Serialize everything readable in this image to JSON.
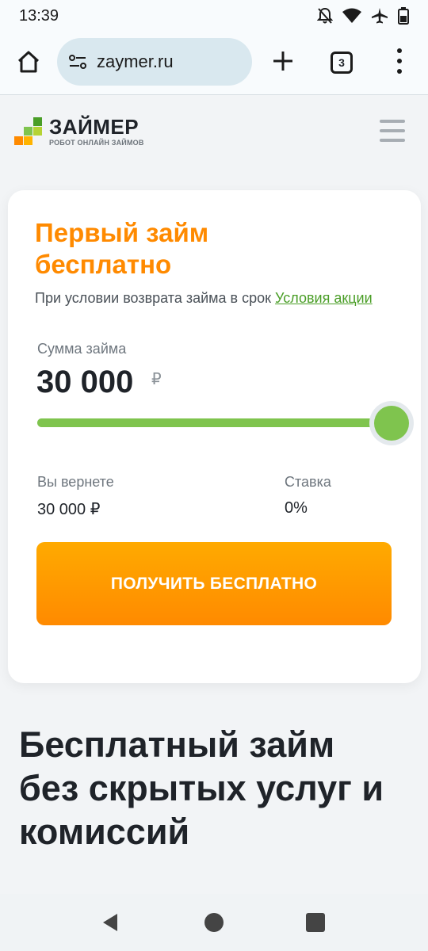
{
  "status_bar": {
    "time": "13:39",
    "icons": [
      "notifications-off-icon",
      "wifi-icon",
      "airplane-icon",
      "battery-icon"
    ]
  },
  "browser": {
    "url": "zaymer.ru",
    "tab_count": "3",
    "icons": [
      "home-icon",
      "site-settings-icon",
      "new-tab-icon",
      "tabs-icon",
      "menu-icon"
    ]
  },
  "site_header": {
    "logo_title": "ЗАЙМЕР",
    "logo_subtitle": "РОБОТ ОНЛАЙН ЗАЙМОВ",
    "menu_icon": "hamburger-icon"
  },
  "card": {
    "title": "Первый займ бесплатно",
    "condition_text": "При условии возврата займа в срок",
    "condition_link": "Условия акции",
    "amount_label": "Сумма займа",
    "amount_value": "30 000",
    "amount_currency": "₽",
    "slider_fraction": 1.0,
    "return_label": "Вы вернете",
    "return_value": "30 000 ₽",
    "rate_label": "Ставка",
    "rate_value": "0%",
    "cta_label": "ПОЛУЧИТЬ БЕСПЛАТНО"
  },
  "section": {
    "title": "Бесплатный займ без скрытых услуг и комиссий"
  },
  "colors": {
    "accent_orange": "#ff8a00",
    "accent_green": "#7fc44e",
    "link_green": "#4a9e27"
  },
  "nav_bar": {
    "icons": [
      "back-icon",
      "home-circle-icon",
      "recents-icon"
    ]
  }
}
